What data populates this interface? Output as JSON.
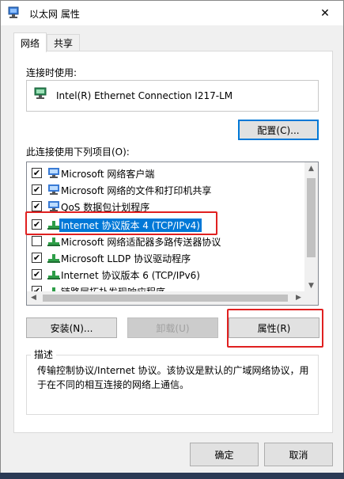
{
  "window": {
    "title": "以太网 属性",
    "close_glyph": "✕"
  },
  "tabs": [
    {
      "label": "网络",
      "active": true
    },
    {
      "label": "共享",
      "active": false
    }
  ],
  "connect_using_label": "连接时使用:",
  "adapter_name": "Intel(R) Ethernet Connection I217-LM",
  "configure_button": "配置(C)...",
  "items_label": "此连接使用下列项目(O):",
  "items": [
    {
      "label": "Microsoft 网络客户端",
      "checked": true,
      "icon": "network-client-icon",
      "selected": false
    },
    {
      "label": "Microsoft 网络的文件和打印机共享",
      "checked": true,
      "icon": "network-client-icon",
      "selected": false
    },
    {
      "label": "QoS 数据包计划程序",
      "checked": true,
      "icon": "network-client-icon",
      "selected": false
    },
    {
      "label": "Internet 协议版本 4 (TCP/IPv4)",
      "checked": true,
      "icon": "protocol-icon",
      "selected": true
    },
    {
      "label": "Microsoft 网络适配器多路传送器协议",
      "checked": false,
      "icon": "protocol-icon",
      "selected": false
    },
    {
      "label": "Microsoft LLDP 协议驱动程序",
      "checked": true,
      "icon": "protocol-icon",
      "selected": false
    },
    {
      "label": "Internet 协议版本 6 (TCP/IPv6)",
      "checked": true,
      "icon": "protocol-icon",
      "selected": false
    },
    {
      "label": "链路层拓扑发现响应程序",
      "checked": true,
      "icon": "protocol-icon",
      "selected": false
    }
  ],
  "buttons": {
    "install": "安装(N)...",
    "uninstall": "卸载(U)",
    "properties": "属性(R)"
  },
  "description": {
    "title": "描述",
    "text": "传输控制协议/Internet 协议。该协议是默认的广域网络协议，用于在不同的相互连接的网络上通信。"
  },
  "footer": {
    "ok": "确定",
    "cancel": "取消"
  },
  "colors": {
    "accent": "#0078d7",
    "highlight": "#e02020"
  }
}
